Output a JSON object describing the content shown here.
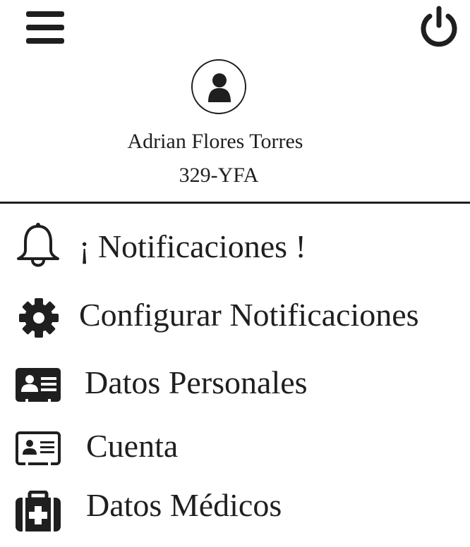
{
  "header": {
    "menu_icon": "hamburger-menu-icon",
    "power_icon": "power-icon"
  },
  "profile": {
    "avatar_icon": "user-icon",
    "name": "Adrian Flores Torres",
    "id": "329-YFA"
  },
  "menu": {
    "items": [
      {
        "label": "¡ Notificaciones !",
        "icon": "bell-icon"
      },
      {
        "label": "Configurar Notificaciones",
        "icon": "gear-icon"
      },
      {
        "label": "Datos Personales",
        "icon": "id-card-icon"
      },
      {
        "label": "Cuenta",
        "icon": "id-card-outline-icon"
      },
      {
        "label": "Datos Médicos",
        "icon": "medkit-icon"
      }
    ]
  },
  "colors": {
    "foreground": "#1f1f1f",
    "background": "#ffffff"
  }
}
